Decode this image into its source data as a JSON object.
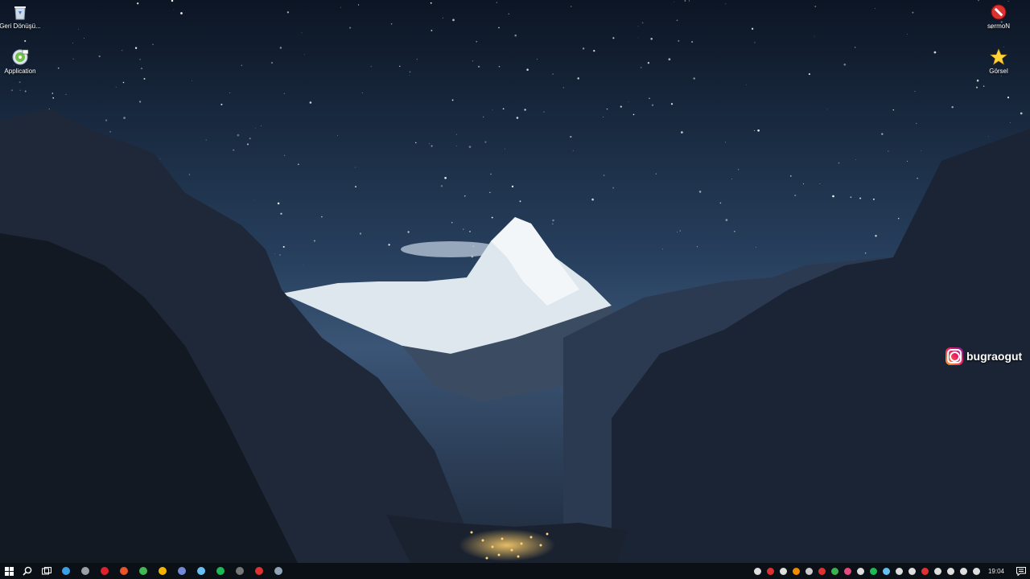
{
  "desktop": {
    "left_icons": [
      {
        "label": "Geri Dönüşü...",
        "icon": "recycle-bin-icon"
      },
      {
        "label": "Application",
        "icon": "application-disc-icon"
      }
    ],
    "right_icons": [
      {
        "label": "sermoN",
        "icon": "no-entry-icon"
      },
      {
        "label": "Görsel",
        "icon": "star-icon"
      }
    ],
    "badge": {
      "text": "bugraogut",
      "icon": "instagram-icon"
    }
  },
  "taskbar": {
    "pinned": [
      {
        "name": "start-button",
        "icon": "windows-logo-icon"
      },
      {
        "name": "search-button",
        "icon": "search-icon"
      },
      {
        "name": "task-view-button",
        "icon": "task-view-icon"
      },
      {
        "name": "edge-app",
        "icon": "edge-icon",
        "color": "#3aa0e6"
      },
      {
        "name": "app-gray",
        "icon": "settings-icon",
        "color": "#9aa0a6"
      },
      {
        "name": "opera-app",
        "icon": "opera-icon",
        "color": "#e0202a"
      },
      {
        "name": "app-orange",
        "icon": "app-icon",
        "color": "#e8552b"
      },
      {
        "name": "app-green",
        "icon": "app-icon",
        "color": "#3fb950"
      },
      {
        "name": "chrome-app",
        "icon": "chrome-icon",
        "color": "#f2b400"
      },
      {
        "name": "discord-app",
        "icon": "discord-icon",
        "color": "#7289da"
      },
      {
        "name": "steam-app",
        "icon": "steam-icon",
        "color": "#66c0f4"
      },
      {
        "name": "spotify-app",
        "icon": "spotify-icon",
        "color": "#1db954"
      },
      {
        "name": "app-circle",
        "icon": "app-icon",
        "color": "#777777"
      },
      {
        "name": "app-red",
        "icon": "app-icon",
        "color": "#e03131"
      },
      {
        "name": "calculator-app",
        "icon": "calculator-icon",
        "color": "#8ea3b8"
      }
    ],
    "tray": [
      {
        "icon": "game-icon",
        "color": "#dddddd"
      },
      {
        "icon": "mic-red-icon",
        "color": "#e03131"
      },
      {
        "icon": "chevron-left-icon",
        "color": "#dddddd"
      },
      {
        "icon": "cloud-icon",
        "color": "#f08c00"
      },
      {
        "icon": "pen-icon",
        "color": "#cccccc"
      },
      {
        "icon": "app-red-icon",
        "color": "#e03131"
      },
      {
        "icon": "app-green-icon",
        "color": "#37b24d"
      },
      {
        "icon": "app-pink-icon",
        "color": "#e64980"
      },
      {
        "icon": "app-white-icon",
        "color": "#dddddd"
      },
      {
        "icon": "spotify-icon",
        "color": "#1db954"
      },
      {
        "icon": "steam-icon",
        "color": "#66c0f4"
      },
      {
        "icon": "app-white-icon",
        "color": "#dddddd"
      },
      {
        "icon": "app-white-icon",
        "color": "#dddddd"
      },
      {
        "icon": "app-red-icon",
        "color": "#e03131"
      },
      {
        "icon": "app-white-icon",
        "color": "#dddddd"
      },
      {
        "icon": "microphone-icon",
        "color": "#dddddd"
      },
      {
        "icon": "network-icon",
        "color": "#dddddd"
      },
      {
        "icon": "volume-icon",
        "color": "#dddddd"
      }
    ],
    "clock": "19:04",
    "notification_icon": "notification-icon"
  }
}
